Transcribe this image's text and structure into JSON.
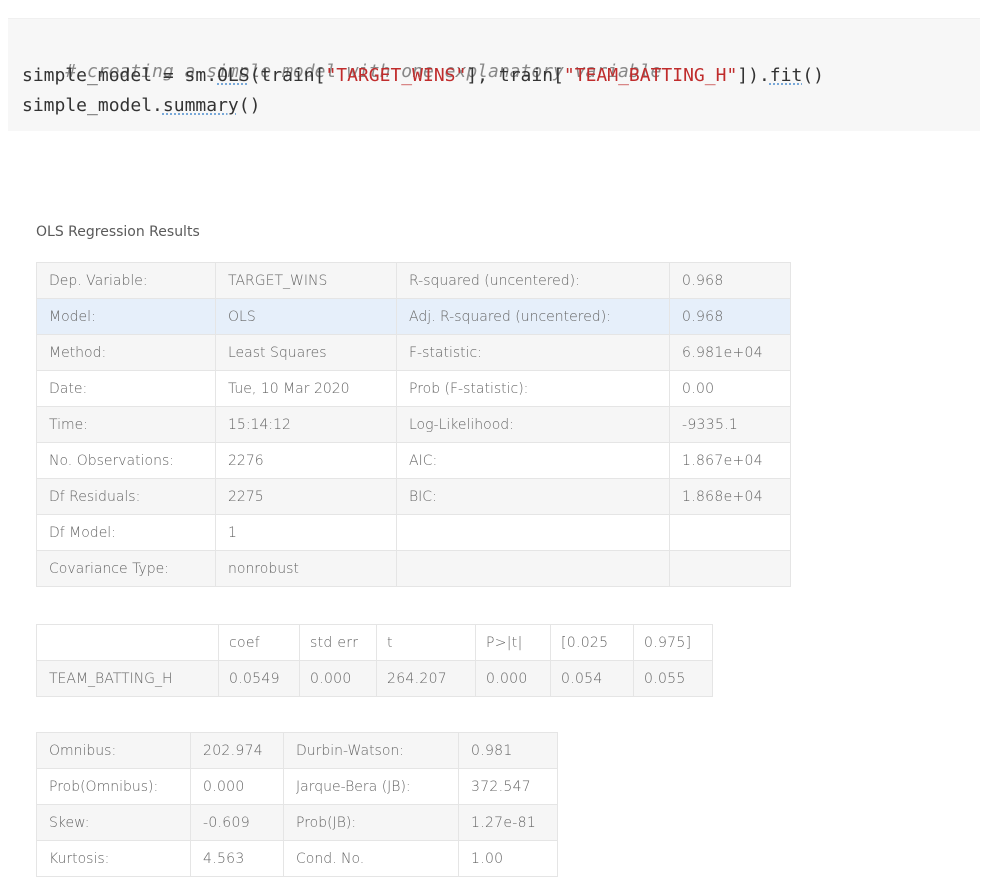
{
  "code": {
    "line1_comment": "# creating a simple model with one explanatory variable",
    "line2": {
      "a": "simple_model = sm.",
      "ols": "OLS",
      "b": "(train[",
      "str1": "\"TARGET_WINS\"",
      "c": "], train[",
      "str2": "\"TEAM_BATTING_H\"",
      "d": "]).",
      "fit": "fit",
      "e": "()"
    },
    "line3": {
      "a": "simple_model.",
      "summary": "summary",
      "b": "()"
    }
  },
  "results": {
    "caption": "OLS Regression Results",
    "main_table": {
      "rows": [
        [
          "Dep. Variable:",
          "TARGET_WINS",
          "R-squared (uncentered):",
          "0.968"
        ],
        [
          "Model:",
          "OLS",
          "Adj. R-squared (uncentered):",
          "0.968"
        ],
        [
          "Method:",
          "Least Squares",
          "F-statistic:",
          "6.981e+04"
        ],
        [
          "Date:",
          "Tue, 10 Mar 2020",
          "Prob (F-statistic):",
          "0.00"
        ],
        [
          "Time:",
          "15:14:12",
          "Log-Likelihood:",
          "-9335.1"
        ],
        [
          "No. Observations:",
          "2276",
          "AIC:",
          "1.867e+04"
        ],
        [
          "Df Residuals:",
          "2275",
          "BIC:",
          "1.868e+04"
        ],
        [
          "Df Model:",
          "1",
          "",
          ""
        ],
        [
          "Covariance Type:",
          "nonrobust",
          "",
          ""
        ]
      ]
    },
    "coef_table": {
      "header": [
        "",
        "coef",
        "std err",
        "t",
        "P>|t|",
        "[0.025",
        "0.975]"
      ],
      "rows": [
        [
          "TEAM_BATTING_H",
          "0.0549",
          "0.000",
          "264.207",
          "0.000",
          "0.054",
          "0.055"
        ]
      ]
    },
    "diag_table": {
      "rows": [
        [
          "Omnibus:",
          "202.974",
          "Durbin-Watson:",
          "0.981"
        ],
        [
          "Prob(Omnibus):",
          "0.000",
          "Jarque-Bera (JB):",
          "372.547"
        ],
        [
          "Skew:",
          "-0.609",
          "Prob(JB):",
          "1.27e-81"
        ],
        [
          "Kurtosis:",
          "4.563",
          "Cond. No.",
          "1.00"
        ]
      ]
    }
  },
  "colors": {
    "code_background": "#f7f7f7",
    "string": "#c02c2c",
    "comment": "#888888",
    "row_shade": "#f6f6f6",
    "row_highlight": "#e6effa",
    "border": "#e5e5e5"
  }
}
